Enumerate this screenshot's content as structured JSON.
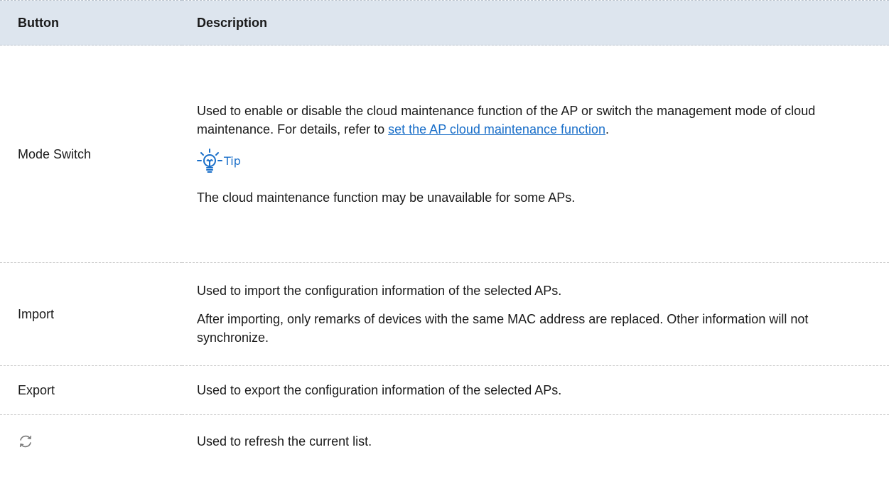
{
  "header": {
    "col_button": "Button",
    "col_description": "Description"
  },
  "rows": [
    {
      "button": "Mode Switch",
      "desc_text": "Used to enable or disable the cloud maintenance function of the AP or switch the management mode of cloud maintenance. For details, refer to ",
      "desc_link": "set the AP cloud maintenance function",
      "desc_end": ".",
      "tip_label": "Tip",
      "tip_text": "The cloud maintenance function may be unavailable for some APs."
    },
    {
      "button": "Import",
      "desc_1": "Used to import the configuration information of the selected APs.",
      "desc_2": "After importing, only remarks of devices with the same MAC address are replaced. Other information will not synchronize."
    },
    {
      "button": "Export",
      "desc_1": "Used to export the configuration information of the selected APs."
    },
    {
      "button_icon": "refresh-icon",
      "desc_1": "Used to refresh the current list."
    }
  ],
  "colors": {
    "header_bg": "#dde5ee",
    "link": "#1a6fc9",
    "tip_icon": "#1a6fc9"
  }
}
